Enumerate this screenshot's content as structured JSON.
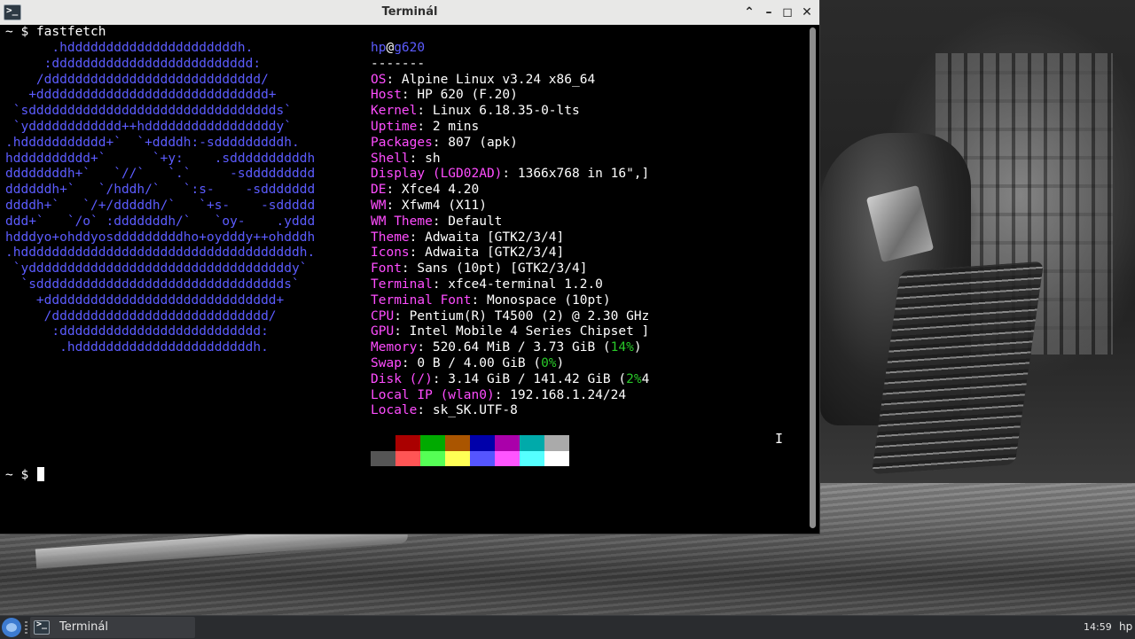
{
  "window": {
    "title": "Terminál"
  },
  "terminal": {
    "command_prompt": "~ $ ",
    "command": "fastfetch",
    "logo_lines": [
      "      .hddddddddddddddddddddddh.",
      "     :dddddddddddddddddddddddddd:",
      "    /dddddddddddddddddddddddddddd/",
      "   +dddddddddddddddddddddddddddddd+",
      " `sdddddddddddddddddddddddddddddddds`",
      " `ydddddddddddd++hdddddddddddddddddy`",
      ".hddddddddddd+`  `+ddddh:-sdddddddddh.",
      "hdddddddddd+`      `+y:    .sddddddddddh",
      "ddddddddh+`   `//`   `.`     -sddddddddd",
      "ddddddh+`   `/hddh/`   `:s-    -sddddddd",
      "ddddh+`   `/+/dddddh/`   `+s-    -sddddd",
      "ddd+`   `/o` :dddddddh/`   `oy-    .yddd",
      "hdddyo+ohddyosdddddddddho+oydddy++ohdddh",
      ".hddddddddddddddddddddddddddddddddddddh.",
      " `yddddddddddddddddddddddddddddddddddy`",
      "  `sdddddddddddddddddddddddddddddddds`",
      "    +dddddddddddddddddddddddddddddd+",
      "     /dddddddddddddddddddddddddddd/",
      "      :dddddddddddddddddddddddddd:",
      "       .hdddddddddddddddddddddddh."
    ],
    "info": {
      "user": "hp",
      "at": "@",
      "host": "g620",
      "separator": "-------",
      "rows": [
        {
          "key": "OS",
          "value": ": Alpine Linux v3.24 x86_64"
        },
        {
          "key": "Host",
          "value": ": HP 620 (F.20)"
        },
        {
          "key": "Kernel",
          "value": ": Linux 6.18.35-0-lts"
        },
        {
          "key": "Uptime",
          "value": ": 2 mins"
        },
        {
          "key": "Packages",
          "value": ": 807 (apk)"
        },
        {
          "key": "Shell",
          "value": ": sh"
        },
        {
          "key": "Display (LGD02AD)",
          "value": ": 1366x768 in 16\",]"
        },
        {
          "key": "DE",
          "value": ": Xfce4 4.20"
        },
        {
          "key": "WM",
          "value": ": Xfwm4 (X11)"
        },
        {
          "key": "WM Theme",
          "value": ": Default"
        },
        {
          "key": "Theme",
          "value": ": Adwaita [GTK2/3/4]"
        },
        {
          "key": "Icons",
          "value": ": Adwaita [GTK2/3/4]"
        },
        {
          "key": "Font",
          "value": ": Sans (10pt) [GTK2/3/4]"
        },
        {
          "key": "Terminal",
          "value": ": xfce4-terminal 1.2.0"
        },
        {
          "key": "Terminal Font",
          "value": ": Monospace (10pt)"
        },
        {
          "key": "CPU",
          "value": ": Pentium(R) T4500 (2) @ 2.30 GHz"
        },
        {
          "key": "GPU",
          "value": ": Intel Mobile 4 Series Chipset ]"
        },
        {
          "key": "Memory",
          "value": ": 520.64 MiB / 3.73 GiB (",
          "pct": "14%",
          "tail": ")"
        },
        {
          "key": "Swap",
          "value": ": 0 B / 4.00 GiB (",
          "pct": "0%",
          "tail": ")"
        },
        {
          "key": "Disk (/)",
          "value": ": 3.14 GiB / 141.42 GiB (",
          "pct": "2%",
          "tail": "4"
        },
        {
          "key": "Local IP (wlan0)",
          "value": ": 192.168.1.24/24"
        },
        {
          "key": "Locale",
          "value": ": sk_SK.UTF-8"
        }
      ]
    },
    "palette": {
      "normal": [
        "#000000",
        "#aa0000",
        "#00aa00",
        "#aa5500",
        "#0000aa",
        "#aa00aa",
        "#00aaaa",
        "#aaaaaa"
      ],
      "bright": [
        "#555555",
        "#ff5555",
        "#55ff55",
        "#ffff55",
        "#5555ff",
        "#ff55ff",
        "#55ffff",
        "#ffffff"
      ]
    },
    "prompt": "~ $ "
  },
  "taskbar": {
    "task_label": "Terminál",
    "clock": "14:59",
    "user": "hp"
  }
}
